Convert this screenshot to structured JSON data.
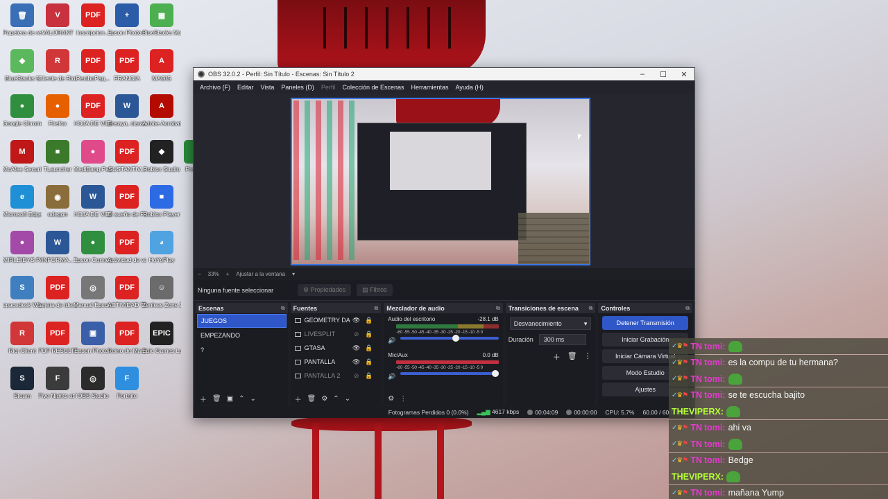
{
  "desktop": {
    "icons": [
      {
        "label": "Papelera de reciclaje",
        "glyph": "🗑",
        "color": "#3a6fb5"
      },
      {
        "label": "VALORANT",
        "glyph": "V",
        "color": "#c8313e"
      },
      {
        "label": "Inscripcion...",
        "glyph": "PDF",
        "color": "#d22"
      },
      {
        "label": "Epson Photo+ Tool",
        "glyph": "+",
        "color": "#2b5ca8"
      },
      {
        "label": "BlueStacks Multi-Insta...",
        "glyph": "▦",
        "color": "#4caf50"
      },
      {
        "label": "BlueStacks 5",
        "glyph": "◆",
        "color": "#5cb85c"
      },
      {
        "label": "Cliente de Riot",
        "glyph": "R",
        "color": "#d13639"
      },
      {
        "label": "ReciboPag...",
        "glyph": "PDF",
        "color": "#d22"
      },
      {
        "label": "FRANCIA",
        "glyph": "PDF",
        "color": "#d22"
      },
      {
        "label": "MAGIS",
        "glyph": "A",
        "color": "#d22"
      },
      {
        "label": "Google Chrome",
        "glyph": "●",
        "color": "#2f8f3e"
      },
      {
        "label": "Firefox",
        "glyph": "●",
        "color": "#e66000"
      },
      {
        "label": "HOJA DE VIDA TONA...",
        "glyph": "PDF",
        "color": "#d22"
      },
      {
        "label": "Ensayo, claras de la...",
        "glyph": "W",
        "color": "#2b5797"
      },
      {
        "label": "Adobe Acrobat",
        "glyph": "A",
        "color": "#b30b00"
      },
      {
        "label": "McAfee Security Sca...",
        "glyph": "M",
        "color": "#c01818"
      },
      {
        "label": "TLauncher",
        "glyph": "■",
        "color": "#3b7a2a"
      },
      {
        "label": "MediBang Paint Pro",
        "glyph": "●",
        "color": "#e04a8b"
      },
      {
        "label": "SUSTANTIV...",
        "glyph": "PDF",
        "color": "#d22"
      },
      {
        "label": "Roblox Studio",
        "glyph": "◆",
        "color": "#222"
      },
      {
        "label": "Proce...",
        "glyph": "P",
        "color": "#2a8a3a"
      },
      {
        "label": "Microsoft Edge",
        "glyph": "e",
        "color": "#1f8fd6"
      },
      {
        "label": "odegon",
        "glyph": "◉",
        "color": "#8a6d3b"
      },
      {
        "label": "HOJA DE VIDA",
        "glyph": "W",
        "color": "#2b5797"
      },
      {
        "label": "El sueño de Pongo",
        "glyph": "PDF",
        "color": "#d22"
      },
      {
        "label": "Roblox Player",
        "glyph": "■",
        "color": "#2d6be4"
      },
      {
        "label": "MIRLEIDYS PAOLA (Uni...",
        "glyph": "●",
        "color": "#a34aa8"
      },
      {
        "label": "INFORMA...",
        "glyph": "W",
        "color": "#2b5797"
      },
      {
        "label": "Epson Connect Site",
        "glyph": "●",
        "color": "#2f8f3e"
      },
      {
        "label": "Actividad de valores",
        "glyph": "PDF",
        "color": "#d22"
      },
      {
        "label": "HoYoPlay",
        "glyph": "◕",
        "color": "#4fa3e0"
      },
      {
        "label": "spacedesk Window...",
        "glyph": "S",
        "color": "#3f7fc0"
      },
      {
        "label": "tarjeta de identidad",
        "glyph": "PDF",
        "color": "#d22"
      },
      {
        "label": "Manual Epson L32...",
        "glyph": "◎",
        "color": "#777"
      },
      {
        "label": "ACTIVIDAD TIPOS DE...",
        "glyph": "PDF",
        "color": "#d22"
      },
      {
        "label": "Zenless Zone Zero",
        "glyph": "☺",
        "color": "#6b6b6b"
      },
      {
        "label": "Riot Client",
        "glyph": "R",
        "color": "#d13639"
      },
      {
        "label": "PDF RESULTAD...",
        "glyph": "PDF",
        "color": "#d22"
      },
      {
        "label": "Epson Photo+",
        "glyph": "▣",
        "color": "#3a5ea8"
      },
      {
        "label": "Reino de Marshark",
        "glyph": "PDF",
        "color": "#d22"
      },
      {
        "label": "Epic Games Launcher",
        "glyph": "EPIC",
        "color": "#222"
      },
      {
        "label": "Steam",
        "glyph": "S",
        "color": "#1b2838"
      },
      {
        "label": "Five Nights at Freddy's Inte...",
        "glyph": "F",
        "color": "#3b3b3b"
      },
      {
        "label": "OBS Studio",
        "glyph": "◎",
        "color": "#2b2b2b"
      },
      {
        "label": "Fortnite",
        "glyph": "F",
        "color": "#2e8fe0"
      }
    ]
  },
  "obs": {
    "window_title": "OBS 32.0.2 - Perfil: Sin Título - Escenas: Sin Título 2",
    "window_buttons": {
      "minimize": "–",
      "maximize": "☐",
      "close": "✕"
    },
    "menu": [
      "Archivo (F)",
      "Editar",
      "Vista",
      "Paneles (D)",
      "Perfil",
      "Colección de Escenas",
      "Herramientas",
      "Ayuda (H)"
    ],
    "zoom": {
      "minus": "−",
      "level": "33%",
      "plus": "+",
      "fit": "Ajustar a la ventana",
      "arrow": "▾"
    },
    "source_toolbar": {
      "no_selection": "Ninguna fuente seleccionar",
      "properties": "Propiedades",
      "filters": "Filtros"
    },
    "scenes": {
      "title": "Escenas",
      "items": [
        "JUEGOS",
        "EMPEZANDO",
        "?"
      ],
      "active_index": 0
    },
    "sources": {
      "title": "Fuentes",
      "items": [
        {
          "name": "GEOMETRY DASH",
          "visible": true
        },
        {
          "name": "LIVESPLIT",
          "visible": false
        },
        {
          "name": "GTASA",
          "visible": true
        },
        {
          "name": "PANTALLA",
          "visible": true
        },
        {
          "name": "PANTALLA 2",
          "visible": false
        }
      ]
    },
    "mixer": {
      "title": "Mezclador de audio",
      "channels": [
        {
          "name": "Audio del escritorio",
          "db": "-28.1 dB",
          "volume": 0.6
        },
        {
          "name": "Mic/Aux",
          "db": "0.0 dB",
          "volume": 1.0
        }
      ],
      "scale": "-60 -55 -50 -45 -40 -35 -30 -25 -20 -15 -10 -5 0"
    },
    "transitions": {
      "title": "Transiciones de escena",
      "selected": "Desvanecimiento",
      "duration_label": "Duración",
      "duration": "300 ms"
    },
    "controls": {
      "title": "Controles",
      "buttons": [
        "Detener Transmisión",
        "Iniciar Grabación",
        "Iniciar Cámara Virtual",
        "Modo Estudio",
        "Ajustes"
      ]
    },
    "status": {
      "dropped": "Fotogramas Perdidos 0 (0.0%)",
      "bitrate": "4617 kbps",
      "stream_time": "00:04:09",
      "rec_time": "00:00:00",
      "cpu": "CPU: 5.7%",
      "fps": "60.00 / 60.00 FPS"
    }
  },
  "chat": [
    {
      "user": "tomi",
      "msg": "",
      "emote": true,
      "badges": true
    },
    {
      "user": "tomi",
      "msg": "es la compu de tu hermana?",
      "emote": false,
      "badges": true
    },
    {
      "user": "tomi",
      "msg": "",
      "emote": true,
      "badges": true
    },
    {
      "user": "tomi",
      "msg": "se te escucha bajito",
      "emote": false,
      "badges": true
    },
    {
      "user": "THEVIPERX",
      "msg": "",
      "emote": true,
      "badges": false
    },
    {
      "user": "tomi",
      "msg": "ahi va",
      "emote": false,
      "badges": true
    },
    {
      "user": "tomi",
      "msg": "",
      "emote": true,
      "badges": true
    },
    {
      "user": "tomi",
      "msg": "Bedge",
      "emote": false,
      "badges": true
    },
    {
      "user": "THEVIPERX",
      "msg": "",
      "emote": true,
      "badges": false
    },
    {
      "user": "tomi",
      "msg": "mañana Yump",
      "emote": false,
      "badges": true
    }
  ],
  "chat_badge_prefix": "TN",
  "colors": {
    "accent": "#2f57c8",
    "chat_user": "#e63ad0",
    "chat_user_alt": "#b6ff3a",
    "bitrate_ok": "#3cc25a"
  }
}
